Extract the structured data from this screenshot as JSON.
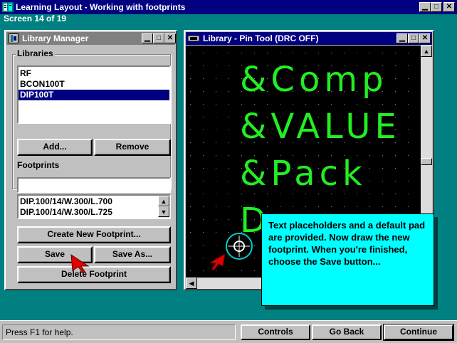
{
  "app": {
    "title": "Learning Layout - Working with footprints",
    "screen_label": "Screen  14 of 19"
  },
  "library_manager": {
    "title": "Library Manager",
    "libraries_label": "Libraries",
    "libraries": [
      "RF",
      "BCON100T",
      "DIP100T"
    ],
    "selected_library": "DIP100T",
    "add_label": "Add...",
    "remove_label": "Remove",
    "footprints_label": "Footprints",
    "footprint_filter_value": "",
    "footprints": [
      "DIP.100/14/W.300/L.700",
      "DIP.100/14/W.300/L.725"
    ],
    "create_label": "Create New Footprint...",
    "save_label": "Save",
    "save_as_label": "Save As...",
    "delete_label": "Delete Footprint"
  },
  "pin_tool": {
    "title": "Library - Pin Tool (DRC OFF)",
    "placeholders": [
      "&Comp",
      "&VALUE",
      "&Pack",
      "D"
    ]
  },
  "callout": {
    "text": "Text placeholders and a default pad are provided. Now draw the new footprint. When you're finished, choose the Save button..."
  },
  "status": {
    "help_text": "Press F1 for help.",
    "controls_label": "Controls",
    "go_back_label": "Go Back",
    "continue_label": "Continue"
  },
  "colors": {
    "desktop": "#008080",
    "title_active": "#000080",
    "placeholder_text": "#22ee22",
    "callout_bg": "#00ffff"
  }
}
